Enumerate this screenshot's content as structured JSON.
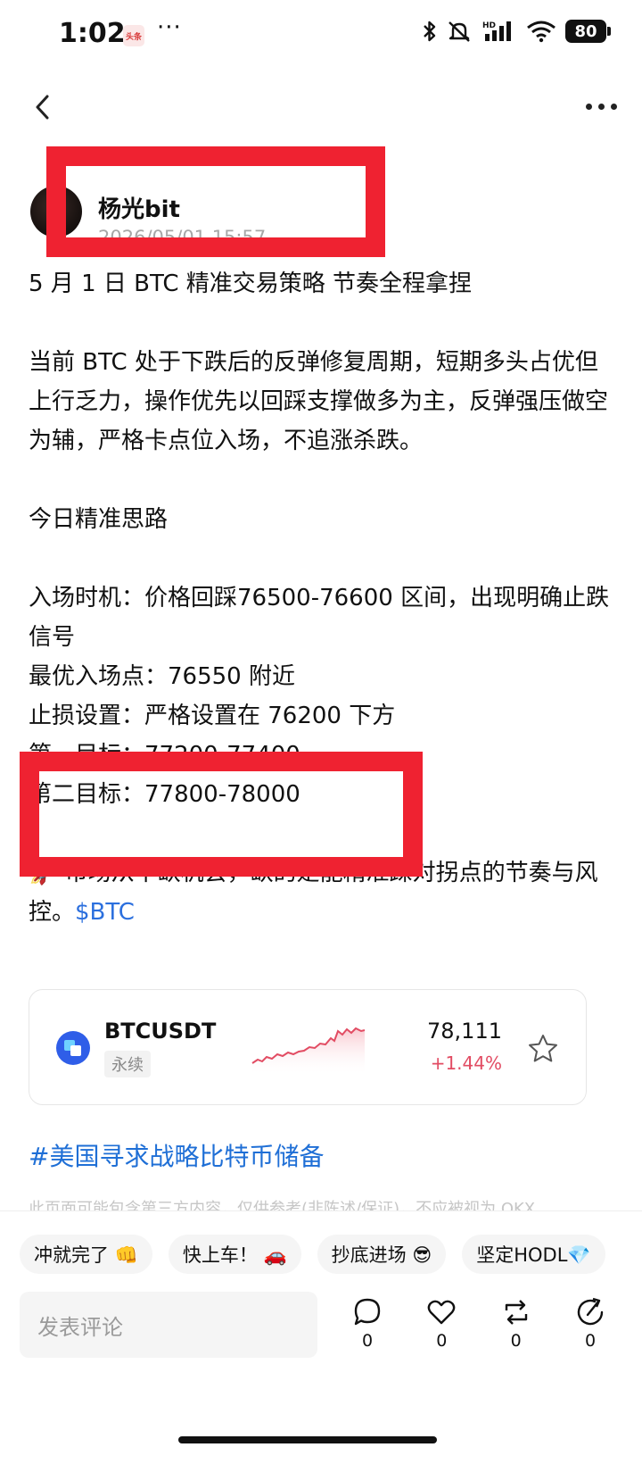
{
  "status_bar": {
    "time": "1:02",
    "app_badge": "头条",
    "dots": "···",
    "battery": "80"
  },
  "author": {
    "name": "杨光bit",
    "time": "2026/05/01 15:57"
  },
  "post": {
    "title": "5 月 1 日 BTC 精准交易策略 节奏全程拿捏",
    "intro": "当前 BTC 处于下跌后的反弹修复周期，短期多头占优但上行乏力，操作优先以回踩支撑做多为主，反弹强压做空为辅，严格卡点位入场，不追涨杀跌。",
    "section_heading": "今日精准思路",
    "entry": "入场时机：价格回踩76500-76600 区间，出现明确止跌信号",
    "best_entry": "最优入场点：76550 附近",
    "stop_loss": "止损设置：严格设置在 76200 下方",
    "target1": "第一目标：77200-77400",
    "target2": "第二目标：77800-78000",
    "closing": "🚀 市场从不缺机会，缺的是能精准踩对拐点的节奏与风控。",
    "ticker_link": "$BTC"
  },
  "ticker_card": {
    "symbol": "BTCUSDT",
    "contract": "永续",
    "price": "78,111",
    "change": "+1.44%"
  },
  "hashtag": "#美国寻求战略比特币储备",
  "disclaimer": "此页面可能包含第三方内容，仅供参考(非陈述/保证)，不应被视为 OKX",
  "chips": [
    "冲就完了 👊",
    "快上车！ 🚗",
    "抄底进场 😎",
    "坚定HODL💎"
  ],
  "comment_placeholder": "发表评论",
  "actions": {
    "comment_count": "0",
    "like_count": "0",
    "repost_count": "0",
    "share_count": "0"
  },
  "colors": {
    "highlight_red": "#ef2231",
    "link_blue": "#1f6fd6",
    "change_red": "#e24c63"
  },
  "icons": [
    "back-icon",
    "more-icon",
    "bluetooth-icon",
    "mute-icon",
    "signal-icon",
    "wifi-icon",
    "battery-icon",
    "star-icon",
    "comment-icon",
    "like-icon",
    "repost-icon",
    "share-icon"
  ]
}
